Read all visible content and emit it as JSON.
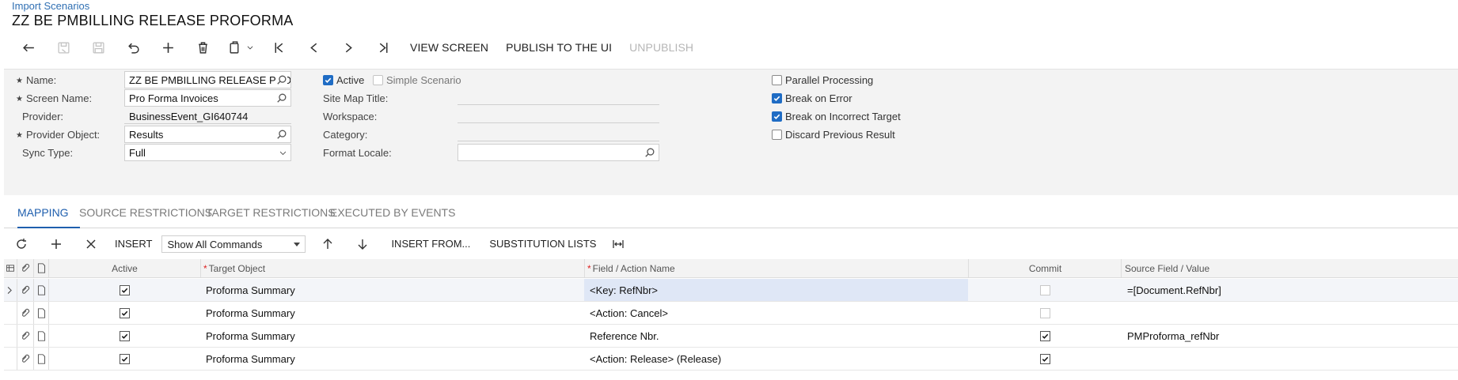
{
  "breadcrumb": "Import Scenarios",
  "title": "ZZ BE PMBILLING RELEASE PROFORMA",
  "toolbar": {
    "view_screen": "VIEW SCREEN",
    "publish": "PUBLISH TO THE UI",
    "unpublish": "UNPUBLISH"
  },
  "form": {
    "name_label": "Name:",
    "name_value": "ZZ BE PMBILLING RELEASE PROFORMA",
    "screen_name_label": "Screen Name:",
    "screen_name_value": "Pro Forma Invoices",
    "provider_label": "Provider:",
    "provider_value": "BusinessEvent_GI640744",
    "provider_object_label": "Provider Object:",
    "provider_object_value": "Results",
    "sync_type_label": "Sync Type:",
    "sync_type_value": "Full",
    "active_label": "Active",
    "simple_scenario_label": "Simple Scenario",
    "site_map_title_label": "Site Map Title:",
    "workspace_label": "Workspace:",
    "category_label": "Category:",
    "format_locale_label": "Format Locale:",
    "format_locale_value": "",
    "parallel_processing_label": "Parallel Processing",
    "break_on_error_label": "Break on Error",
    "break_on_incorrect_target_label": "Break on Incorrect Target",
    "discard_previous_result_label": "Discard Previous Result"
  },
  "tabs": {
    "mapping": "MAPPING",
    "source_restrictions": "SOURCE RESTRICTIONS",
    "target_restrictions": "TARGET RESTRICTIONS",
    "executed_by_events": "EXECUTED BY EVENTS"
  },
  "grid_toolbar": {
    "insert": "INSERT",
    "commands_select": "Show All Commands",
    "insert_from": "INSERT FROM...",
    "substitution_lists": "SUBSTITUTION LISTS"
  },
  "grid": {
    "columns": {
      "active": "Active",
      "target_object": "Target Object",
      "field_action_name": "Field / Action Name",
      "commit": "Commit",
      "source_field_value": "Source Field / Value"
    },
    "rows": [
      {
        "active": true,
        "target_object": "Proforma Summary",
        "field": "<Key: RefNbr>",
        "commit": false,
        "source": "=[Document.RefNbr]"
      },
      {
        "active": true,
        "target_object": "Proforma Summary",
        "field": "<Action: Cancel>",
        "commit": false,
        "source": ""
      },
      {
        "active": true,
        "target_object": "Proforma Summary",
        "field": "Reference Nbr.",
        "commit": true,
        "source": "PMProforma_refNbr"
      },
      {
        "active": true,
        "target_object": "Proforma Summary",
        "field": "<Action: Release> (Release)",
        "commit": true,
        "source": ""
      }
    ]
  },
  "colors": {
    "accent": "#1f5fae",
    "checkbox": "#1f6cc4",
    "form_bg": "#f3f3f3",
    "selected_cell": "#dfe7f6"
  }
}
